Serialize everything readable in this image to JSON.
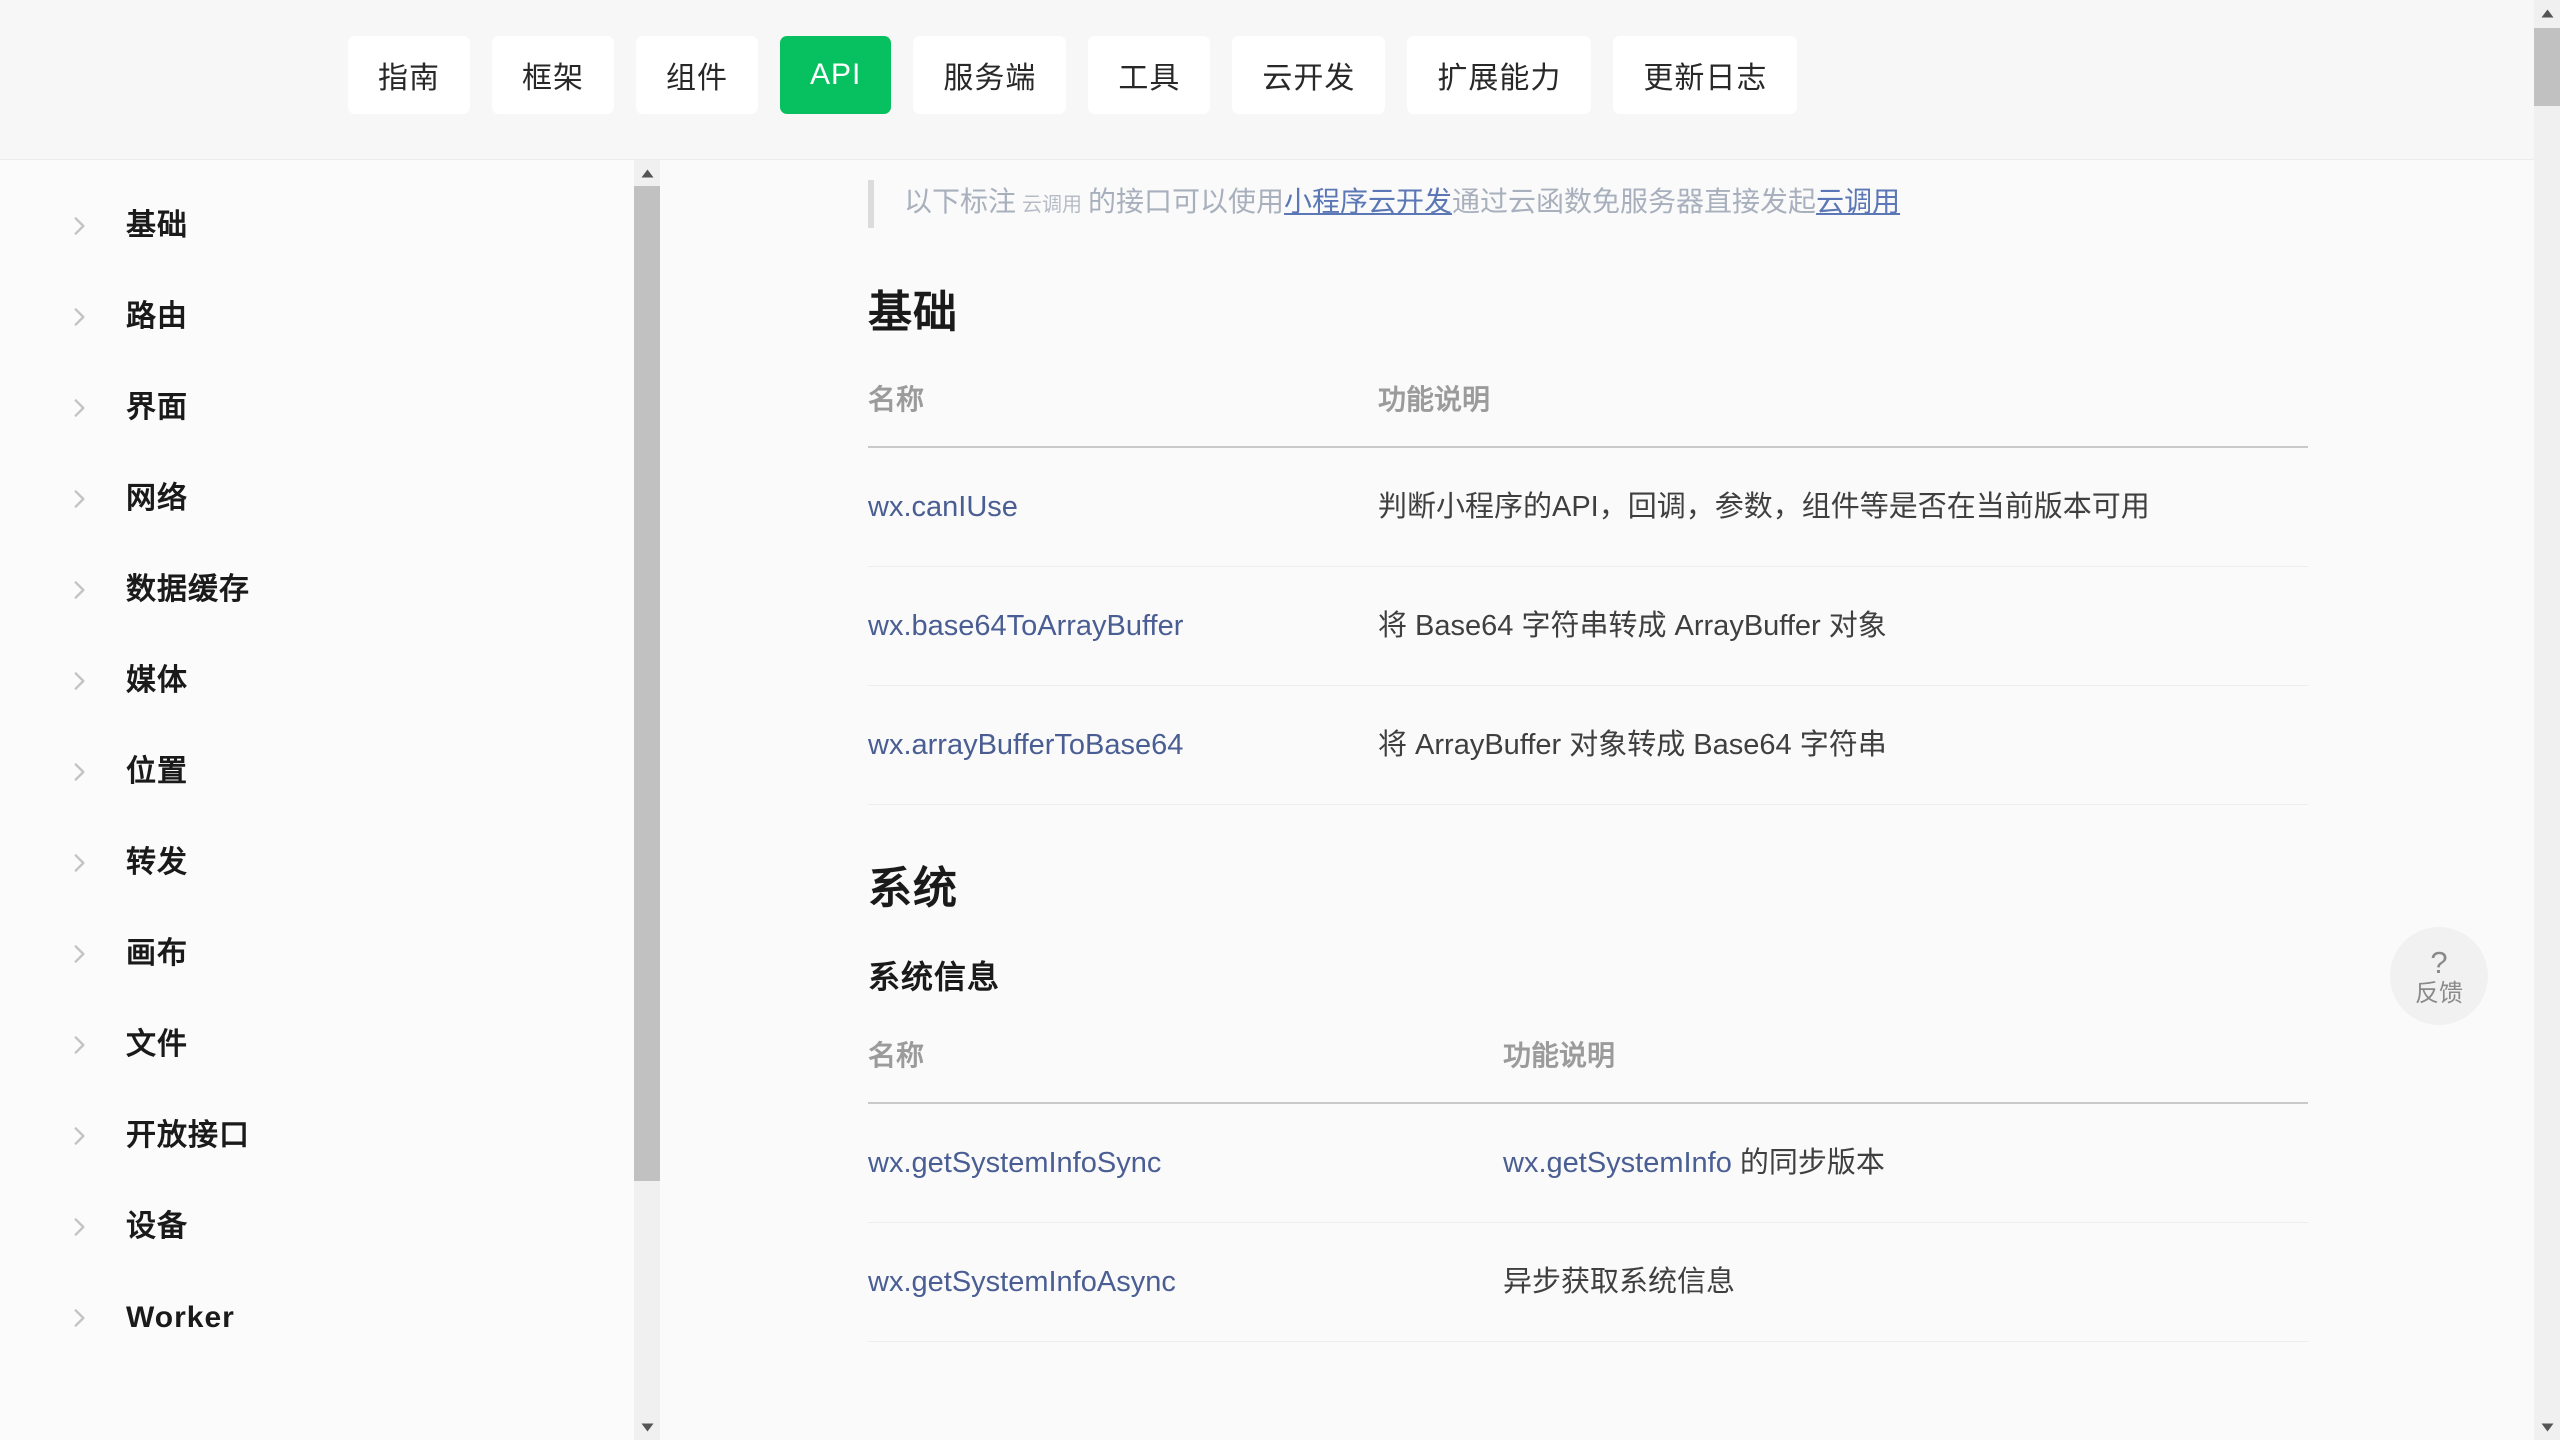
{
  "nav": {
    "tabs": [
      {
        "label": "指南",
        "active": false
      },
      {
        "label": "框架",
        "active": false
      },
      {
        "label": "组件",
        "active": false
      },
      {
        "label": "API",
        "active": true
      },
      {
        "label": "服务端",
        "active": false
      },
      {
        "label": "工具",
        "active": false
      },
      {
        "label": "云开发",
        "active": false
      },
      {
        "label": "扩展能力",
        "active": false
      },
      {
        "label": "更新日志",
        "active": false
      }
    ],
    "active_color": "#07c160"
  },
  "sidebar": {
    "items": [
      {
        "label": "基础"
      },
      {
        "label": "路由"
      },
      {
        "label": "界面"
      },
      {
        "label": "网络"
      },
      {
        "label": "数据缓存"
      },
      {
        "label": "媒体"
      },
      {
        "label": "位置"
      },
      {
        "label": "转发"
      },
      {
        "label": "画布"
      },
      {
        "label": "文件"
      },
      {
        "label": "开放接口"
      },
      {
        "label": "设备"
      },
      {
        "label": "Worker"
      }
    ]
  },
  "note": {
    "prefix": "以下标注",
    "tag": "云调用",
    "middle": "的接口可以使用",
    "link1": "小程序云开发",
    "middle2": "通过云函数免服务器直接发起",
    "link2": "云调用"
  },
  "sections": [
    {
      "heading": "基础",
      "columns": [
        "名称",
        "功能说明"
      ],
      "rows": [
        {
          "name": "wx.canIUse",
          "desc": "判断小程序的API，回调，参数，组件等是否在当前版本可用",
          "desc_link": ""
        },
        {
          "name": "wx.base64ToArrayBuffer",
          "desc": "将 Base64 字符串转成 ArrayBuffer 对象",
          "desc_link": ""
        },
        {
          "name": "wx.arrayBufferToBase64",
          "desc": "将 ArrayBuffer 对象转成 Base64 字符串",
          "desc_link": ""
        }
      ]
    },
    {
      "heading": "系统",
      "subheading": "系统信息",
      "columns": [
        "名称",
        "功能说明"
      ],
      "rows": [
        {
          "name": "wx.getSystemInfoSync",
          "desc_link": "wx.getSystemInfo",
          "desc": " 的同步版本"
        },
        {
          "name": "wx.getSystemInfoAsync",
          "desc_link": "",
          "desc": "异步获取系统信息"
        }
      ]
    }
  ],
  "feedback": {
    "icon": "?",
    "label": "反馈"
  }
}
